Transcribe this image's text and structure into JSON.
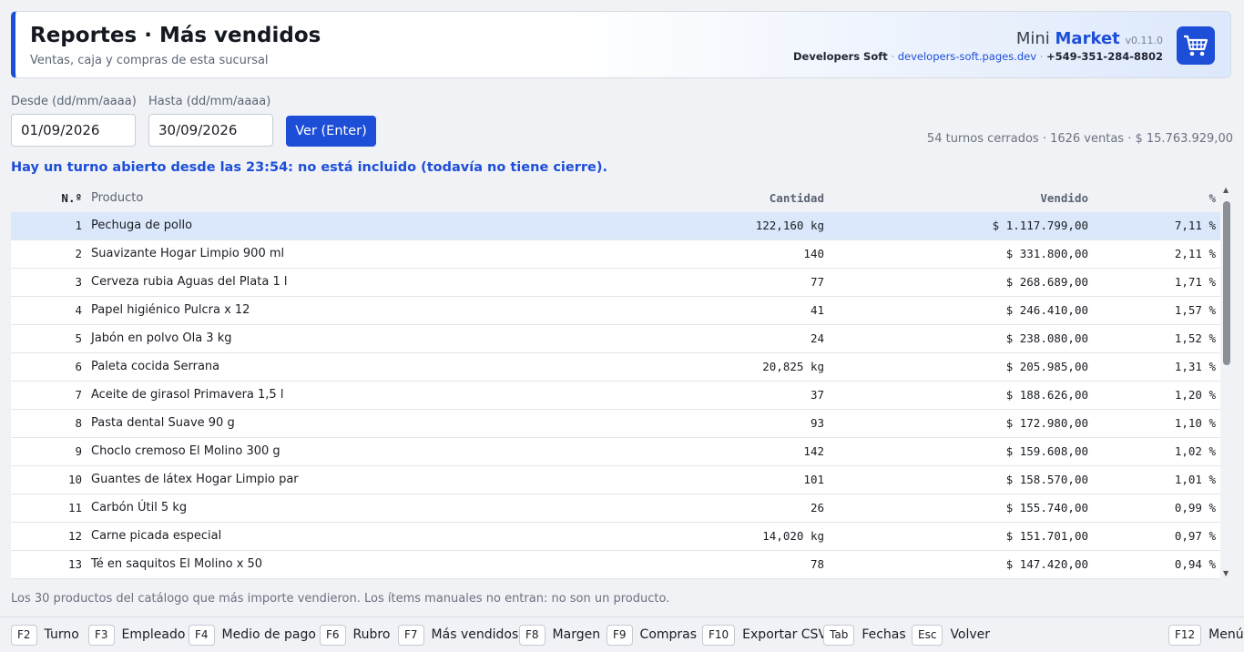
{
  "header": {
    "title": "Reportes · Más vendidos",
    "subtitle": "Ventas, caja y compras de esta sucursal",
    "brand_1": "Mini",
    "brand_2": "Market",
    "version": "v0.11.0",
    "company": "Developers Soft",
    "url": "developers-soft.pages.dev",
    "phone": "+549-351-284-8802",
    "logo_icon": "shopping-cart-icon"
  },
  "filters": {
    "from_label": "Desde (dd/mm/aaaa)",
    "from_value": "01/09/2026",
    "to_label": "Hasta (dd/mm/aaaa)",
    "to_value": "30/09/2026",
    "view_button": "Ver (Enter)"
  },
  "summary": "54 turnos cerrados · 1626 ventas · $ 15.763.929,00",
  "warning": "Hay un turno abierto desde las 23:54: no está incluido (todavía no tiene cierre).",
  "table": {
    "headers": {
      "num": "N.º",
      "product": "Producto",
      "qty": "Cantidad",
      "sold": "Vendido",
      "pct": "%"
    },
    "rows": [
      {
        "num": "1",
        "product": "Pechuga de pollo",
        "qty": "122,160 kg",
        "sold": "$ 1.117.799,00",
        "pct": "7,11 %"
      },
      {
        "num": "2",
        "product": "Suavizante Hogar Limpio 900 ml",
        "qty": "140",
        "sold": "$ 331.800,00",
        "pct": "2,11 %"
      },
      {
        "num": "3",
        "product": "Cerveza rubia Aguas del Plata 1 l",
        "qty": "77",
        "sold": "$ 268.689,00",
        "pct": "1,71 %"
      },
      {
        "num": "4",
        "product": "Papel higiénico Pulcra x 12",
        "qty": "41",
        "sold": "$ 246.410,00",
        "pct": "1,57 %"
      },
      {
        "num": "5",
        "product": "Jabón en polvo Ola 3 kg",
        "qty": "24",
        "sold": "$ 238.080,00",
        "pct": "1,52 %"
      },
      {
        "num": "6",
        "product": "Paleta cocida Serrana",
        "qty": "20,825 kg",
        "sold": "$ 205.985,00",
        "pct": "1,31 %"
      },
      {
        "num": "7",
        "product": "Aceite de girasol Primavera 1,5 l",
        "qty": "37",
        "sold": "$ 188.626,00",
        "pct": "1,20 %"
      },
      {
        "num": "8",
        "product": "Pasta dental Suave 90 g",
        "qty": "93",
        "sold": "$ 172.980,00",
        "pct": "1,10 %"
      },
      {
        "num": "9",
        "product": "Choclo cremoso El Molino 300 g",
        "qty": "142",
        "sold": "$ 159.608,00",
        "pct": "1,02 %"
      },
      {
        "num": "10",
        "product": "Guantes de látex Hogar Limpio par",
        "qty": "101",
        "sold": "$ 158.570,00",
        "pct": "1,01 %"
      },
      {
        "num": "11",
        "product": "Carbón Útil 5 kg",
        "qty": "26",
        "sold": "$ 155.740,00",
        "pct": "0,99 %"
      },
      {
        "num": "12",
        "product": "Carne picada especial",
        "qty": "14,020 kg",
        "sold": "$ 151.701,00",
        "pct": "0,97 %"
      },
      {
        "num": "13",
        "product": "Té en saquitos El Molino x 50",
        "qty": "78",
        "sold": "$ 147.420,00",
        "pct": "0,94 %"
      }
    ]
  },
  "footnote": "Los 30 productos del catálogo que más importe vendieron. Los ítems manuales no entran: no son un producto.",
  "shortcuts": [
    {
      "key": "F2",
      "label": "Turno"
    },
    {
      "key": "F3",
      "label": "Empleado"
    },
    {
      "key": "F4",
      "label": "Medio de pago"
    },
    {
      "key": "F6",
      "label": "Rubro"
    },
    {
      "key": "F7",
      "label": "Más vendidos"
    },
    {
      "key": "F8",
      "label": "Margen"
    },
    {
      "key": "F9",
      "label": "Compras"
    },
    {
      "key": "F10",
      "label": "Exportar CSV"
    },
    {
      "key": "Tab",
      "label": "Fechas"
    },
    {
      "key": "Esc",
      "label": "Volver"
    },
    {
      "key": "F12",
      "label": "Menú"
    }
  ],
  "colors": {
    "accent": "#1d4ed8",
    "selected_row": "#dbe8fb"
  }
}
